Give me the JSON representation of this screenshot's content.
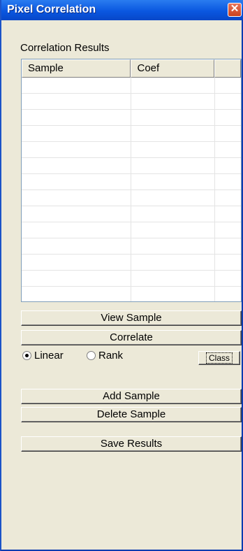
{
  "window": {
    "title": "Pixel Correlation",
    "close_glyph": "✕"
  },
  "results": {
    "label": "Correlation Results",
    "columns": [
      "Sample",
      "Coef",
      ""
    ],
    "rows": []
  },
  "buttons": {
    "view_sample": "View Sample",
    "correlate": "Correlate",
    "class": "Class",
    "add_sample": "Add Sample",
    "delete_sample": "Delete Sample",
    "save_results": "Save Results"
  },
  "method": {
    "options": [
      {
        "label": "Linear",
        "selected": true
      },
      {
        "label": "Rank",
        "selected": false
      }
    ]
  },
  "colors": {
    "titlebar": "#0a57e0",
    "window_bg": "#ece9d8",
    "close_button": "#c8411f"
  }
}
